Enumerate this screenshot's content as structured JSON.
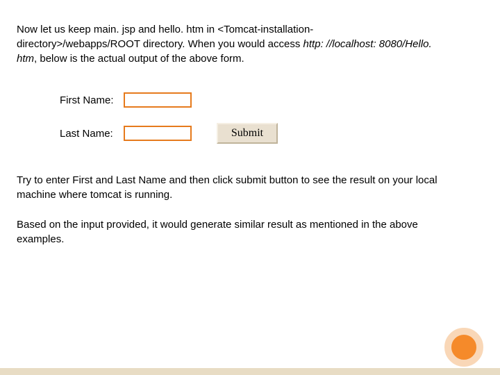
{
  "intro": {
    "part1": "Now let us keep main. jsp and hello. htm in <Tomcat-installation-directory>/webapps/ROOT directory. When you would access ",
    "url": "http: //localhost: 8080/Hello. htm",
    "part2": ", below is the actual output of the above form."
  },
  "form": {
    "first_name_label": "First Name:",
    "last_name_label": "Last Name:",
    "first_name_value": "",
    "last_name_value": "",
    "submit_label": "Submit"
  },
  "body_p1": "Try to enter First and Last Name and then click submit button to see the result on your local machine where tomcat is running.",
  "body_p2": "Based on the input provided, it would generate similar result as mentioned in the above examples.",
  "colors": {
    "input_border": "#e67a1c",
    "button_bg": "#e9e0d0",
    "accent_circle": "#f58a2a",
    "accent_ring": "#f9d7b7",
    "bottom_bar": "#e8dcc4"
  }
}
